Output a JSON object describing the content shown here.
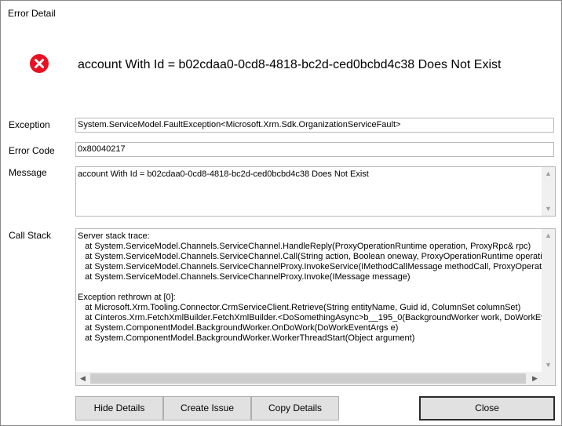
{
  "window": {
    "title": "Error Detail"
  },
  "header": {
    "icon": "error-icon",
    "message": "account With Id = b02cdaa0-0cd8-4818-bc2d-ced0bcbd4c38 Does Not Exist"
  },
  "fields": {
    "exception_label": "Exception",
    "exception_value": "System.ServiceModel.FaultException<Microsoft.Xrm.Sdk.OrganizationServiceFault>",
    "error_code_label": "Error Code",
    "error_code_value": "0x80040217",
    "message_label": "Message",
    "message_value": "account With Id = b02cdaa0-0cd8-4818-bc2d-ced0bcbd4c38 Does Not Exist",
    "call_stack_label": "Call Stack",
    "call_stack_value": "Server stack trace:\n   at System.ServiceModel.Channels.ServiceChannel.HandleReply(ProxyOperationRuntime operation, ProxyRpc& rpc)\n   at System.ServiceModel.Channels.ServiceChannel.Call(String action, Boolean oneway, ProxyOperationRuntime operation, Object[] ins, Object[] outs)\n   at System.ServiceModel.Channels.ServiceChannelProxy.InvokeService(IMethodCallMessage methodCall, ProxyOperationRuntime operation)\n   at System.ServiceModel.Channels.ServiceChannelProxy.Invoke(IMessage message)\n\nException rethrown at [0]:\n   at Microsoft.Xrm.Tooling.Connector.CrmServiceClient.Retrieve(String entityName, Guid id, ColumnSet columnSet)\n   at Cinteros.Xrm.FetchXmlBuilder.FetchXmlBuilder.<DoSomethingAsync>b__195_0(BackgroundWorker work, DoWorkEventArgs args)\n   at System.ComponentModel.BackgroundWorker.OnDoWork(DoWorkEventArgs e)\n   at System.ComponentModel.BackgroundWorker.WorkerThreadStart(Object argument)"
  },
  "buttons": {
    "hide_details": "Hide Details",
    "create_issue": "Create Issue",
    "copy_details": "Copy Details",
    "close": "Close"
  },
  "colors": {
    "error_red": "#e81123",
    "button_face": "#e1e1e1",
    "field_border": "#b8b8b8"
  }
}
